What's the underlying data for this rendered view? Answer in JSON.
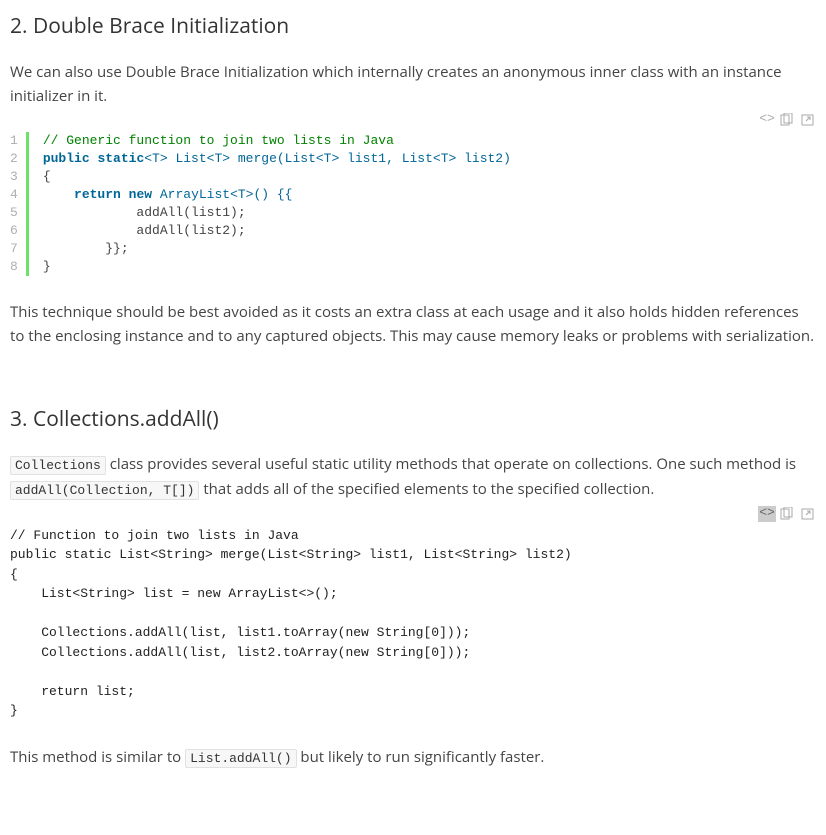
{
  "section2": {
    "heading": "2. Double Brace Initialization",
    "intro": "We can also use Double Brace Initialization which internally creates an anonymous inner class with an instance initializer in it.",
    "outro": "This technique should be best avoided as it costs an extra class at each usage and it also holds hidden references to the enclosing instance and to any captured objects. This may cause memory leaks or problems with serialization.",
    "code": {
      "lines": [
        "1",
        "2",
        "3",
        "4",
        "5",
        "6",
        "7",
        "8"
      ],
      "l1_comment": "// Generic function to join two lists in Java",
      "l2_p1": "public",
      "l2_p2": " ",
      "l2_p3": "static",
      "l2_p4": "<T> List<T> merge(List<T> list1, List<T> list2)",
      "l3": "{",
      "l4_p1": "    ",
      "l4_p2": "return",
      "l4_p3": " ",
      "l4_p4": "new",
      "l4_p5": " ArrayList<T>() {{",
      "l5": "            addAll(list1);",
      "l6": "            addAll(list2);",
      "l7": "        }};",
      "l8": "}"
    }
  },
  "section3": {
    "heading": "3. Collections.addAll()",
    "intro_p1_code": "Collections",
    "intro_p1_text": " class provides several useful static utility methods that operate on collections. One such method is ",
    "intro_p2_code": "addAll(Collection, T[])",
    "intro_p2_text": " that adds all of the specified elements to the specified collection.",
    "code_plain": "// Function to join two lists in Java\npublic static List<String> merge(List<String> list1, List<String> list2)\n{\n    List<String> list = new ArrayList<>();\n\n    Collections.addAll(list, list1.toArray(new String[0]));\n    Collections.addAll(list, list2.toArray(new String[0]));\n\n    return list;\n}",
    "outro_p1": "This method is similar to ",
    "outro_code": "List.addAll()",
    "outro_p2": " but likely to run significantly faster."
  }
}
